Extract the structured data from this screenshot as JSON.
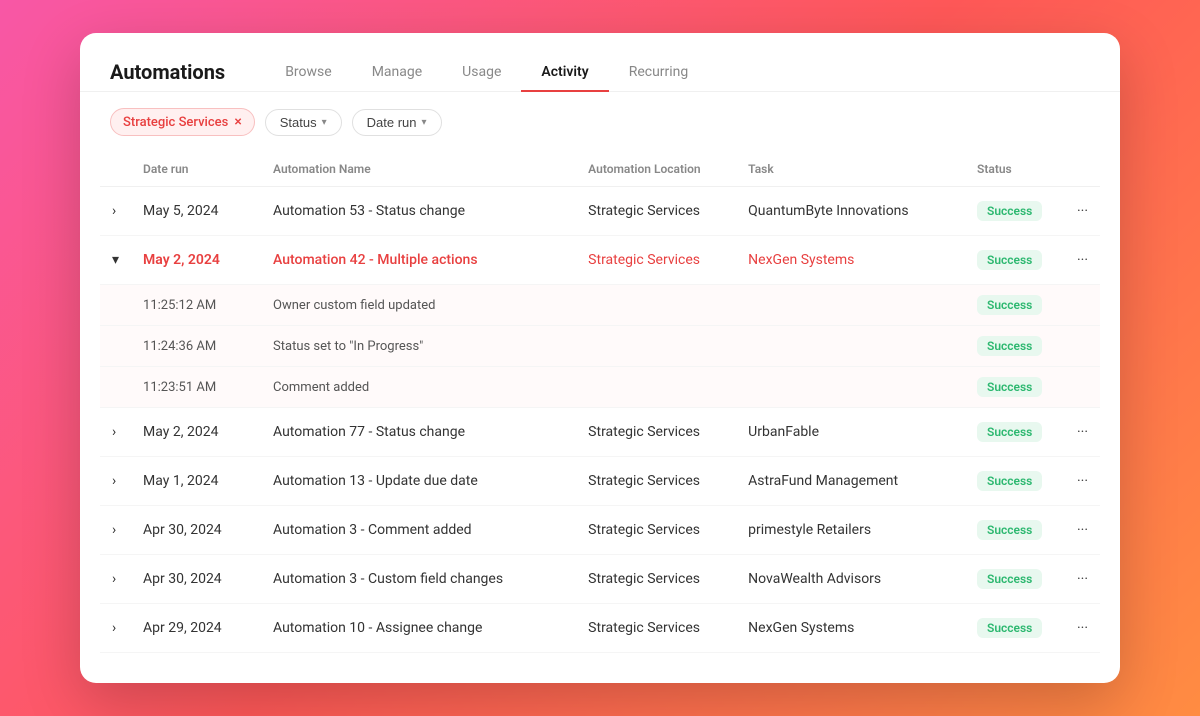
{
  "header": {
    "title": "Automations",
    "tabs": [
      {
        "label": "Browse",
        "active": false
      },
      {
        "label": "Manage",
        "active": false
      },
      {
        "label": "Usage",
        "active": false
      },
      {
        "label": "Activity",
        "active": true
      },
      {
        "label": "Recurring",
        "active": false
      }
    ]
  },
  "filters": {
    "tag": "Strategic Services",
    "status_label": "Status",
    "date_run_label": "Date run"
  },
  "table": {
    "columns": [
      "Date run",
      "Automation Name",
      "Automation Location",
      "Task",
      "Status"
    ],
    "rows": [
      {
        "id": "row1",
        "expanded": false,
        "highlighted": false,
        "date": "May 5, 2024",
        "automation": "Automation 53 - Status change",
        "location": "Strategic Services",
        "task": "QuantumByte Innovations",
        "status": "Success",
        "sub_rows": []
      },
      {
        "id": "row2",
        "expanded": true,
        "highlighted": true,
        "date": "May 2, 2024",
        "automation": "Automation 42 - Multiple actions",
        "location": "Strategic Services",
        "task": "NexGen Systems",
        "status": "Success",
        "sub_rows": [
          {
            "time": "11:25:12 AM",
            "action": "Owner custom field updated",
            "status": "Success"
          },
          {
            "time": "11:24:36 AM",
            "action": "Status set to \"In Progress\"",
            "status": "Success"
          },
          {
            "time": "11:23:51 AM",
            "action": "Comment added",
            "status": "Success"
          }
        ]
      },
      {
        "id": "row3",
        "expanded": false,
        "highlighted": false,
        "date": "May 2, 2024",
        "automation": "Automation 77 - Status change",
        "location": "Strategic Services",
        "task": "UrbanFable",
        "status": "Success",
        "sub_rows": []
      },
      {
        "id": "row4",
        "expanded": false,
        "highlighted": false,
        "date": "May 1, 2024",
        "automation": "Automation 13 - Update due date",
        "location": "Strategic Services",
        "task": "AstraFund Management",
        "status": "Success",
        "sub_rows": []
      },
      {
        "id": "row5",
        "expanded": false,
        "highlighted": false,
        "date": "Apr 30, 2024",
        "automation": "Automation 3 - Comment added",
        "location": "Strategic Services",
        "task": "primestyle Retailers",
        "status": "Success",
        "sub_rows": []
      },
      {
        "id": "row6",
        "expanded": false,
        "highlighted": false,
        "date": "Apr 30, 2024",
        "automation": "Automation 3 - Custom field changes",
        "location": "Strategic Services",
        "task": "NovaWealth Advisors",
        "status": "Success",
        "sub_rows": []
      },
      {
        "id": "row7",
        "expanded": false,
        "highlighted": false,
        "date": "Apr 29, 2024",
        "automation": "Automation 10 - Assignee change",
        "location": "Strategic Services",
        "task": "NexGen Systems",
        "status": "Success",
        "sub_rows": []
      }
    ]
  }
}
